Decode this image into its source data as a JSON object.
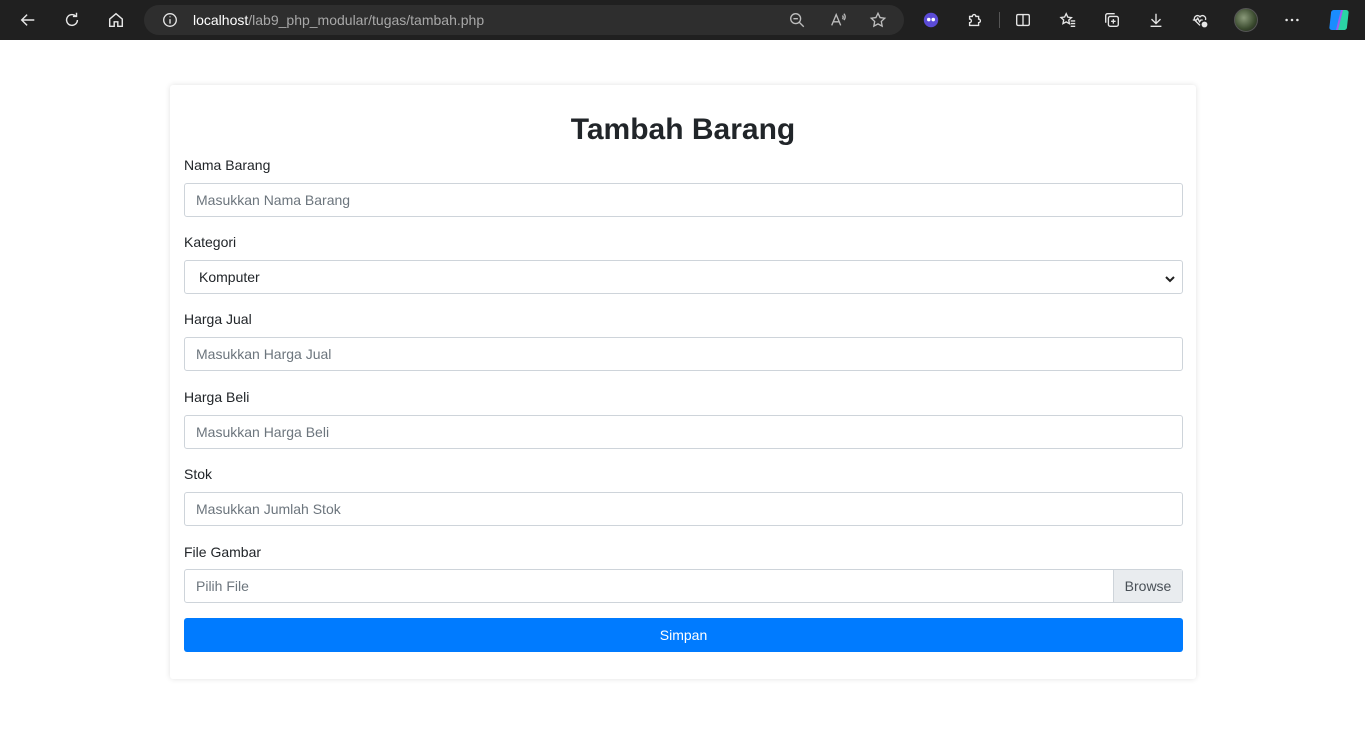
{
  "browser": {
    "url_host": "localhost",
    "url_path": "/lab9_php_modular/tugas/tambah.php"
  },
  "form": {
    "title": "Tambah Barang",
    "nama_label": "Nama Barang",
    "nama_placeholder": "Masukkan Nama Barang",
    "kategori_label": "Kategori",
    "kategori_selected": "Komputer",
    "harga_jual_label": "Harga Jual",
    "harga_jual_placeholder": "Masukkan Harga Jual",
    "harga_beli_label": "Harga Beli",
    "harga_beli_placeholder": "Masukkan Harga Beli",
    "stok_label": "Stok",
    "stok_placeholder": "Masukkan Jumlah Stok",
    "gambar_label": "File Gambar",
    "gambar_placeholder": "Pilih File",
    "browse_label": "Browse",
    "submit_label": "Simpan"
  },
  "colors": {
    "primary": "#007bff",
    "chrome_bg": "#202020"
  },
  "icons": [
    "back-icon",
    "refresh-icon",
    "home-icon",
    "info-icon",
    "zoom-out-icon",
    "read-aloud-icon",
    "favorite-star-icon",
    "extension-bot-icon",
    "extensions-icon",
    "split-screen-icon",
    "favorites-icon",
    "collections-icon",
    "downloads-icon",
    "browser-essentials-icon",
    "profile-avatar",
    "more-icon",
    "copilot-icon",
    "chevron-down-icon"
  ]
}
